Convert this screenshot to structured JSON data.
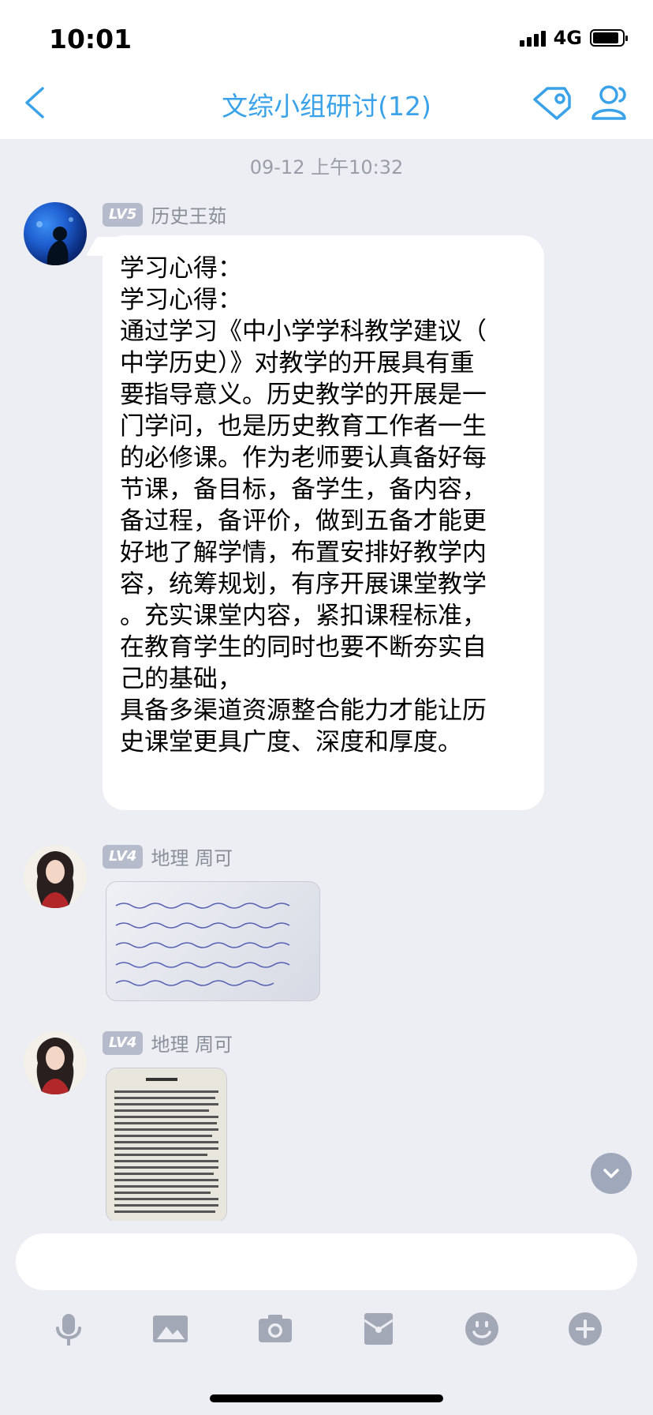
{
  "status": {
    "time": "10:01",
    "network": "4G"
  },
  "nav": {
    "title": "文综小组研讨(12)"
  },
  "chat": {
    "timestamp": "09-12 上午10:32",
    "messages": [
      {
        "level": "LV5",
        "sender": "历史王茹",
        "text": "学习心得：\n学习心得：\n通过学习《中小学学科教学建议（\n中学历史）》对教学的开展具有重\n要指导意义。历史教学的开展是一\n门学问，也是历史教育工作者一生\n的必修课。作为老师要认真备好每\n节课，备目标，备学生，备内容，\n备过程，备评价，做到五备才能更\n好地了解学情，布置安排好教学内\n容，统筹规划，有序开展课堂教学\n。充实课堂内容，紧扣课程标准，\n在教育学生的同时也要不断夯实自\n己的基础，\n具备多渠道资源整合能力才能让历\n史课堂更具广度、深度和厚度。"
      },
      {
        "level": "LV4",
        "sender": "地理 周可"
      },
      {
        "level": "LV4",
        "sender": "地理 周可"
      }
    ]
  },
  "icons": {
    "back": "back-chevron-icon",
    "tag": "tag-icon",
    "members": "group-members-icon",
    "mic": "microphone-icon",
    "image": "image-icon",
    "camera": "camera-icon",
    "redpacket": "red-packet-icon",
    "emoji": "emoji-icon",
    "plus": "plus-icon",
    "scroll": "scroll-down-icon"
  },
  "colors": {
    "accent": "#3aa2e8",
    "background": "#eceef3",
    "tool_gray": "#a2a8b6"
  }
}
